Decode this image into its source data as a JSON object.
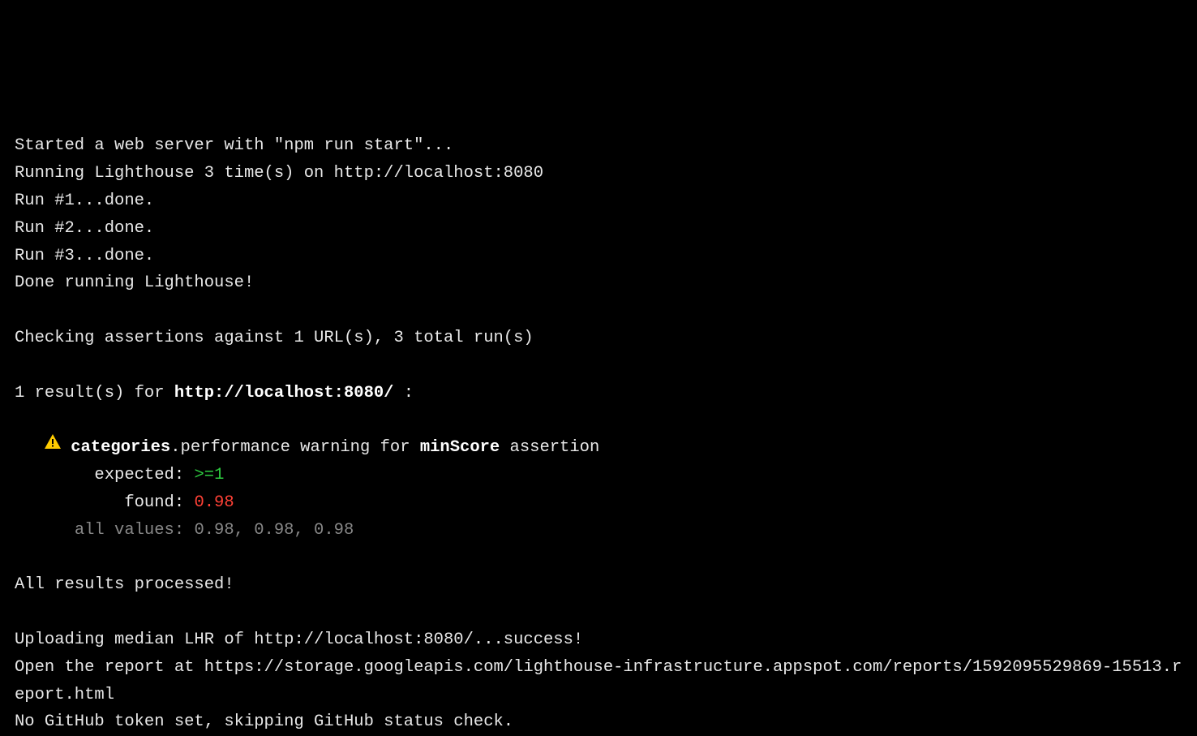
{
  "preamble": [
    "Started a web server with \"npm run start\"...",
    "Running Lighthouse 3 time(s) on http://localhost:8080",
    "Run #1...done.",
    "Run #2...done.",
    "Run #3...done.",
    "Done running Lighthouse!"
  ],
  "checking_line": "Checking assertions against 1 URL(s), 3 total run(s)",
  "results_prefix": "1 result(s) for ",
  "results_url": "http://localhost:8080/",
  "results_suffix": " :",
  "warning": {
    "indent": "   ",
    "category": "categories",
    "perf_text": ".performance warning for ",
    "minscore": "minScore",
    "assertion_suffix": " assertion",
    "expected_label": "        expected: ",
    "expected_op": ">=",
    "expected_val": "1",
    "found_label": "           found: ",
    "found_val": "0.98",
    "allvalues_label": "      all values: ",
    "allvalues_val": "0.98, 0.98, 0.98"
  },
  "processed_line": "All results processed!",
  "upload_line": "Uploading median LHR of http://localhost:8080/...success!",
  "open_report_line": "Open the report at https://storage.googleapis.com/lighthouse-infrastructure.appspot.com/reports/1592095529869-15513.report.html",
  "github_line": "No GitHub token set, skipping GitHub status check."
}
